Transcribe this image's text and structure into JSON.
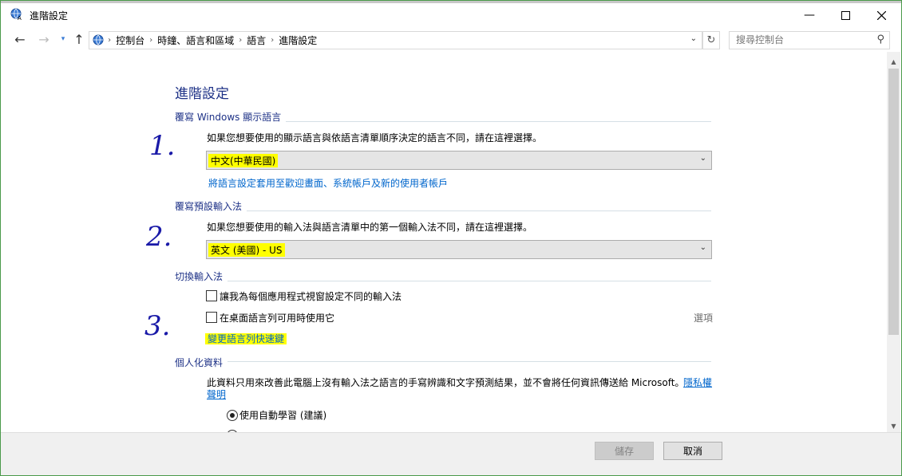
{
  "window": {
    "title": "進階設定"
  },
  "nav": {
    "breadcrumbs": [
      "控制台",
      "時鐘、語言和區域",
      "語言",
      "進階設定"
    ],
    "search_placeholder": "搜尋控制台"
  },
  "page": {
    "heading": "進階設定",
    "display_language": {
      "label": "覆寫 Windows 顯示語言",
      "description": "如果您想要使用的顯示語言與依語言清單順序決定的語言不同，請在這裡選擇。",
      "selected": "中文(中華民國)",
      "apply_link": "將語言設定套用至歡迎畫面、系統帳戶及新的使用者帳戶"
    },
    "input_method": {
      "label": "覆寫預設輸入法",
      "description": "如果您想要使用的輸入法與語言清單中的第一個輸入法不同，請在這裡選擇。",
      "selected": "英文 (美國) - US"
    },
    "switching": {
      "label": "切換輸入法",
      "checkbox1": "讓我為每個應用程式視窗設定不同的輸入法",
      "checkbox2": "在桌面語言列可用時使用它",
      "options_link": "選項",
      "hotkeys_link": "變更語言列快速鍵"
    },
    "personalization": {
      "label": "個人化資料",
      "description_line1": "此資料只用來改善此電腦上沒有輸入法之語言的手寫辨識和文字預測結果，並不會將任何資訊傳送給 Microsoft。",
      "privacy_link_part1": "隱私權",
      "privacy_link_part2": "聲明",
      "radio1": "使用自動學習 (建議)"
    }
  },
  "annotations": {
    "one": "1.",
    "two": "2.",
    "three": "3."
  },
  "footer": {
    "save": "儲存",
    "cancel": "取消"
  },
  "colors": {
    "accent_blue": "#1e3287",
    "link_blue": "#0066cc",
    "highlight": "#ffff00"
  }
}
